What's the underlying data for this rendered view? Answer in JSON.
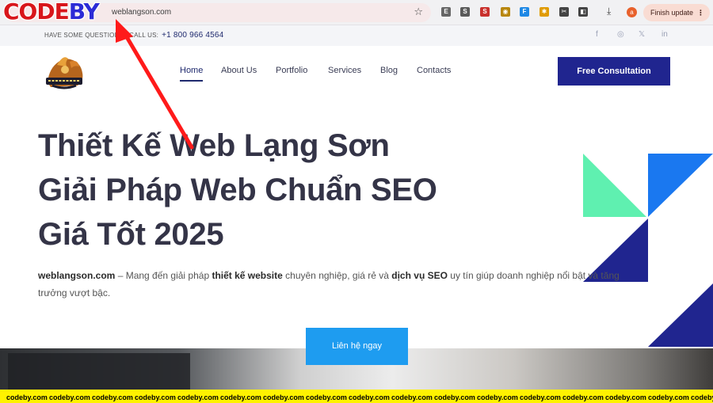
{
  "browser": {
    "url": "weblangson.com",
    "finish_update": "Finish update",
    "avatar_initial": "a",
    "extensions": [
      {
        "name": "e-extension-icon",
        "label": "E",
        "color": "#666666"
      },
      {
        "name": "s-extension-icon",
        "label": "S",
        "color": "#5a5a5a"
      },
      {
        "name": "red-s-extension-icon",
        "label": "S",
        "color": "#c9302c"
      },
      {
        "name": "eye-extension-icon",
        "label": "◉",
        "color": "#b8860b"
      },
      {
        "name": "translate-extension-icon",
        "label": "F",
        "color": "#1e88e5"
      },
      {
        "name": "gear-extension-icon",
        "label": "✱",
        "color": "#e09b00"
      },
      {
        "name": "tool-extension-icon",
        "label": "✂",
        "color": "#444444"
      },
      {
        "name": "puzzle-extension-icon",
        "label": "◧",
        "color": "#444444"
      }
    ]
  },
  "watermark": {
    "logo_part1": "CODE",
    "logo_part2": "BY",
    "strip_text": "codeby.com"
  },
  "topbar": {
    "contact_label": "HAVE SOME QUESTIONS? CALL US:",
    "phone": "+1 800 966 4564",
    "social": [
      "f",
      "◎",
      "𝕏",
      "in"
    ]
  },
  "nav": {
    "items": [
      "Home",
      "About Us",
      "Portfolio",
      "Services",
      "Blog",
      "Contacts"
    ],
    "cta": "Free Consultation"
  },
  "hero": {
    "line1": "Thiết Kế Web Lạng Sơn",
    "line2": "Giải Pháp Web Chuẩn SEO",
    "line3": "Giá Tốt 2025",
    "desc_site": "weblangson.com",
    "desc_part1": " – Mang đến giải pháp ",
    "desc_bold1": "thiết kế website",
    "desc_part2": " chuyên nghiệp, giá rẻ và ",
    "desc_bold2": "dịch vụ SEO",
    "desc_part3": " uy tín giúp doanh nghiệp nổi bật và tăng trưởng vượt bậc.",
    "button": "Liên hệ ngay"
  },
  "colors": {
    "brand_navy": "#20258f",
    "accent_blue": "#1e9cf0",
    "mint": "#5ff0b0",
    "bright_blue": "#1a78f0"
  }
}
